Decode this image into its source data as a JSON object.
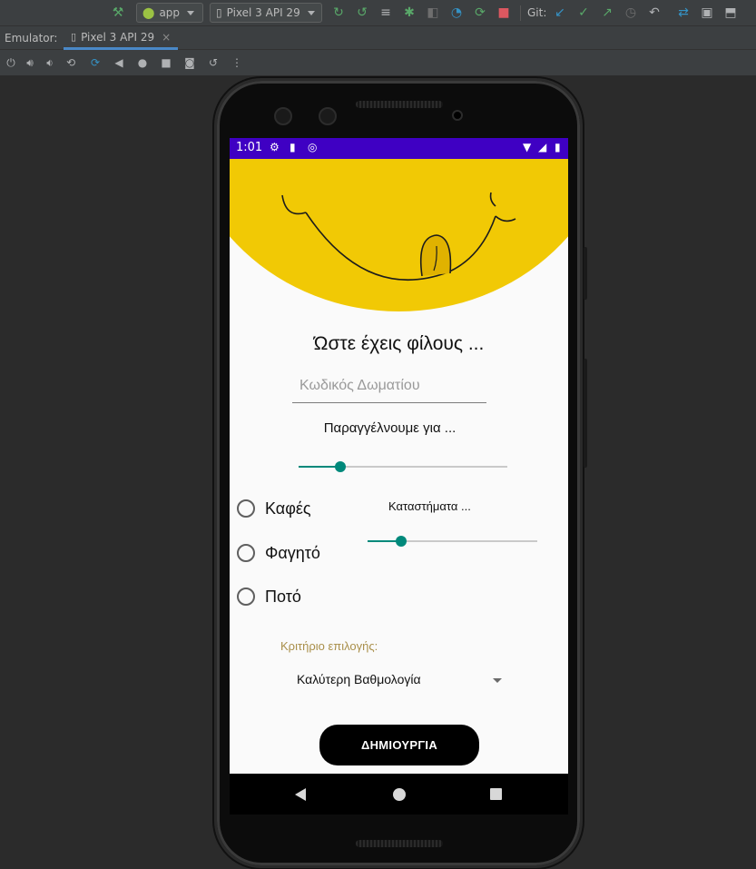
{
  "ide": {
    "run_config": "app",
    "device_selector": "Pixel 3 API 29",
    "git_label": "Git:",
    "icons": [
      "hammer-icon",
      "android-icon",
      "device-icon",
      "rerun-icon",
      "apply-changes-icon",
      "apply-code-icon",
      "logcat-icon",
      "debug-icon",
      "attach-debugger-icon",
      "profile-icon",
      "stop-icon",
      "git-update-icon",
      "git-commit-icon",
      "git-push-icon",
      "git-history-icon",
      "git-rollback-icon",
      "sync-icon",
      "avd-manager-icon",
      "sdk-manager-icon"
    ]
  },
  "emulator": {
    "label": "Emulator:",
    "tab_title": "Pixel 3 API 29",
    "tab_close": "×",
    "controls": [
      "power-icon",
      "volume-up-icon",
      "volume-down-icon",
      "rotate-left-icon",
      "rotate-right-icon",
      "back-icon",
      "home-icon",
      "overview-icon",
      "screenshot-icon",
      "snapshot-icon",
      "more-icon"
    ]
  },
  "device": {
    "status_time": "1:01",
    "colors": {
      "status_bar": "#3f00c3",
      "banner": "#f1c905",
      "accent": "#00897b",
      "button": "#000000"
    }
  },
  "app": {
    "title": "Ώστε έχεις φίλους ...",
    "room_code_placeholder": "Κωδικός Δωματίου",
    "order_for_label": "Παραγγέλνουμε για ...",
    "order_for_slider_value": 0.2,
    "options": [
      {
        "label": "Καφές",
        "checked": false
      },
      {
        "label": "Φαγητό",
        "checked": false
      },
      {
        "label": "Ποτό",
        "checked": false
      }
    ],
    "stores_label": "Καταστήματα ...",
    "stores_slider_value": 0.2,
    "criteria_label": "Κριτήριο επιλογής:",
    "criteria_selected": "Καλύτερη Βαθμολογία",
    "create_button": "ΔΗΜΙΟΥΡΓΙΑ"
  }
}
